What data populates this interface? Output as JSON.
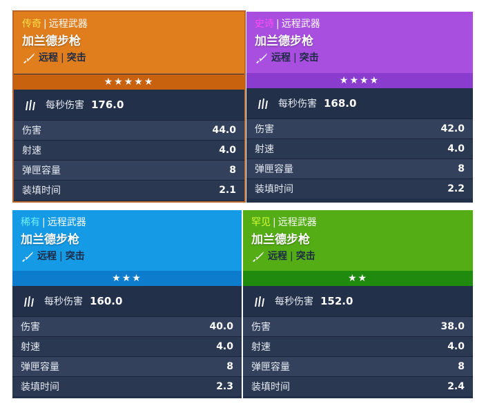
{
  "cards": [
    {
      "rarity": "传奇",
      "category": "远程武器",
      "name": "加兰德步枪",
      "type1": "远程",
      "type2": "突击",
      "stars": "★★★★★",
      "dps_label": "每秒伤害",
      "dps_value": "176.0",
      "stats": [
        {
          "label": "伤害",
          "value": "44.0"
        },
        {
          "label": "射速",
          "value": "4.0"
        },
        {
          "label": "弹匣容量",
          "value": "8"
        },
        {
          "label": "装填时间",
          "value": "2.1"
        }
      ]
    },
    {
      "rarity": "史诗",
      "category": "远程武器",
      "name": "加兰德步枪",
      "type1": "远程",
      "type2": "突击",
      "stars": "★★★★",
      "dps_label": "每秒伤害",
      "dps_value": "168.0",
      "stats": [
        {
          "label": "伤害",
          "value": "42.0"
        },
        {
          "label": "射速",
          "value": "4.0"
        },
        {
          "label": "弹匣容量",
          "value": "8"
        },
        {
          "label": "装填时间",
          "value": "2.2"
        }
      ]
    },
    {
      "rarity": "稀有",
      "category": "远程武器",
      "name": "加兰德步枪",
      "type1": "远程",
      "type2": "突击",
      "stars": "★★★",
      "dps_label": "每秒伤害",
      "dps_value": "160.0",
      "stats": [
        {
          "label": "伤害",
          "value": "40.0"
        },
        {
          "label": "射速",
          "value": "4.0"
        },
        {
          "label": "弹匣容量",
          "value": "8"
        },
        {
          "label": "装填时间",
          "value": "2.3"
        }
      ]
    },
    {
      "rarity": "罕见",
      "category": "远程武器",
      "name": "加兰德步枪",
      "type1": "远程",
      "type2": "突击",
      "stars": "★★",
      "dps_label": "每秒伤害",
      "dps_value": "152.0",
      "stats": [
        {
          "label": "伤害",
          "value": "38.0"
        },
        {
          "label": "射速",
          "value": "4.0"
        },
        {
          "label": "弹匣容量",
          "value": "8"
        },
        {
          "label": "装填时间",
          "value": "2.4"
        }
      ]
    }
  ],
  "colors": {
    "legendary_header": "#e07e1e",
    "legendary_stars_bar": "#c9620f",
    "legendary_rarity_text": "#ffe04a",
    "epic_header": "#a94fe0",
    "epic_stars_bar": "#8a3ccf",
    "epic_rarity_text": "#ff4cf5",
    "rare_header": "#159be6",
    "rare_stars_bar": "#0d7ccc",
    "rare_rarity_text": "#6ff0ff",
    "uncommon_header": "#54ad14",
    "uncommon_stars_bar": "#1f8a0e",
    "uncommon_rarity_text": "#d7ff3a",
    "panel_bg": "#233049"
  },
  "icons": {
    "type_icon": "rifle-icon",
    "dps_icon": "bullets-icon"
  }
}
